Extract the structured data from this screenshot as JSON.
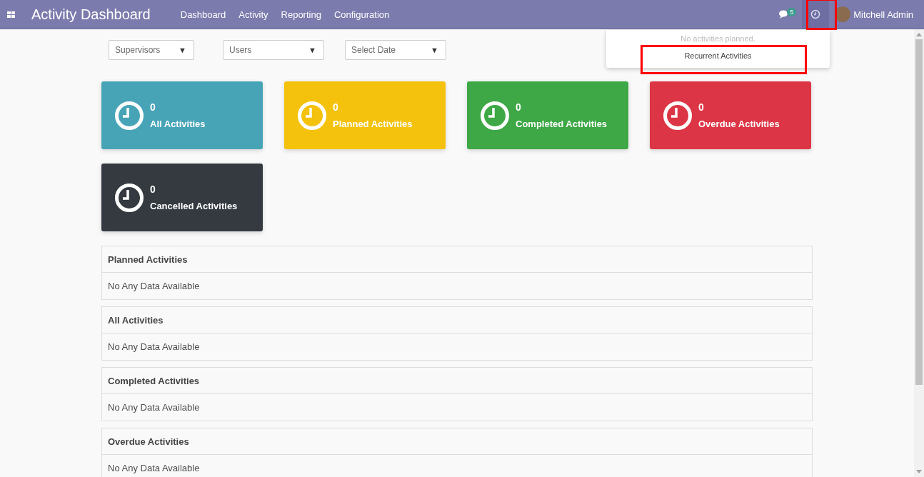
{
  "navbar": {
    "title": "Activity Dashboard",
    "menu": [
      "Dashboard",
      "Activity",
      "Reporting",
      "Configuration"
    ],
    "messages_badge": "5",
    "user": "Mitchell Admin"
  },
  "activity_popover": {
    "message": "No activities planned.",
    "link": "Recurrent Activities"
  },
  "filters": [
    {
      "placeholder": "Supervisors",
      "caret": "▼"
    },
    {
      "placeholder": "Users",
      "caret": "▼"
    },
    {
      "placeholder": "Select Date",
      "caret": "▼"
    }
  ],
  "cards": [
    {
      "count": "0",
      "label": "All Activities",
      "color": "#47a4b7"
    },
    {
      "count": "0",
      "label": "Planned Activities",
      "color": "#f4c20d"
    },
    {
      "count": "0",
      "label": "Completed Activities",
      "color": "#3ea746"
    },
    {
      "count": "0",
      "label": "Overdue Activities",
      "color": "#dc3545"
    },
    {
      "count": "0",
      "label": "Cancelled Activities",
      "color": "#343a40"
    }
  ],
  "sections": [
    {
      "title": "Planned Activities",
      "body": "No Any Data Available"
    },
    {
      "title": "All Activities",
      "body": "No Any Data Available"
    },
    {
      "title": "Completed Activities",
      "body": "No Any Data Available"
    },
    {
      "title": "Overdue Activities",
      "body": "No Any Data Available"
    }
  ]
}
